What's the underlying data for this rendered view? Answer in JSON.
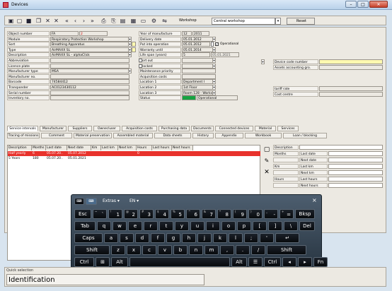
{
  "window": {
    "title": "Devices",
    "minimize": "–",
    "maximize": "□",
    "close": "✕"
  },
  "toolbar": {
    "workshop_label": "Workshop",
    "workshop_value": "Central workshop",
    "reset": "Reset"
  },
  "form": {
    "left": [
      {
        "label": "Object number",
        "value": "FA",
        "extra": "2"
      },
      {
        "label": "Module",
        "value": "Respiratory Protection Workshop"
      },
      {
        "label": "Sort",
        "value": "Breathing Apparatus"
      },
      {
        "label": "Type",
        "value": "AirMAXX SL"
      },
      {
        "label": "Description",
        "value": "AirMAXX SL - alphaClick"
      },
      {
        "label": "Abbreviation",
        "value": ""
      },
      {
        "label": "Licence plate",
        "value": ""
      },
      {
        "label": "Manufacturer type",
        "value": "MSA"
      },
      {
        "label": "Manufacturer no.",
        "value": ""
      },
      {
        "label": "Barcode",
        "value": "74584412"
      },
      {
        "label": "Transponder",
        "value": "AC0123430112"
      },
      {
        "label": "Serial number",
        "value": ""
      },
      {
        "label": "Inventory no.",
        "value": ""
      }
    ],
    "mid": [
      {
        "label": "Year of manufacture",
        "value": "12",
        "value2": "2011"
      },
      {
        "label": "Delivery date",
        "value": "05.01.2012"
      },
      {
        "label": "Put into operation",
        "value": "05.01.2012",
        "value2": "Operational"
      },
      {
        "label": "Warranty until",
        "value": "05.01.2014"
      },
      {
        "label": "Life span (years)",
        "value": "5",
        "value2": "05.01.2021"
      },
      {
        "label": "Sort out",
        "value": ""
      },
      {
        "label": "Blocked",
        "value": ""
      },
      {
        "label": "Maintenance priority",
        "value": ""
      },
      {
        "label": "Acquisition costs",
        "value": ""
      },
      {
        "label": "Location 1",
        "value": "Department I"
      },
      {
        "label": "Location 2",
        "value": "1st Floor"
      },
      {
        "label": "Location 3",
        "value": "Room 128 - Workshop"
      },
      {
        "label": "Status",
        "value": "Operational"
      }
    ],
    "right": [
      {
        "label": "Device code number",
        "value": ""
      },
      {
        "label": "Assets accounting gro.",
        "value": ""
      },
      {
        "label": "tariff rate",
        "value": ""
      },
      {
        "label": "Cost centre",
        "value": ""
      }
    ]
  },
  "tabs_row1": [
    "Service intervals",
    "Manufacturer",
    "Suppliers",
    "Owner/user",
    "Acquisition costs",
    "Purchasing data",
    "Documents",
    "Connected devices",
    "Material",
    "Services"
  ],
  "tabs_row2": [
    "Tracing of missions",
    "Comment",
    "Material preservation",
    "Assembled material",
    "Data sheets",
    "History",
    "Appendix",
    "Workbook",
    "Loan / blocking"
  ],
  "table": {
    "headers": [
      "Description",
      "Months",
      "Last date",
      "Next date",
      "Km",
      "Last km",
      "Next km",
      "Hours",
      "Last hours",
      "Next hours"
    ],
    "rows": [
      [
        "Half yearly",
        "6",
        "05.07.20..",
        "05.07.2012",
        "",
        "",
        "",
        "0",
        "",
        ""
      ],
      [
        "5 Years",
        "180",
        "05.07.20..",
        "05.01.2021",
        "",
        "",
        "",
        "",
        "",
        ""
      ]
    ]
  },
  "detail": {
    "rows": [
      {
        "label": "Description",
        "value": ""
      },
      {
        "label": "Months",
        "value": "Last date"
      },
      {
        "label": "",
        "value": "Next date"
      },
      {
        "label": "Km",
        "value": "Last km"
      },
      {
        "label": "",
        "value": "Next km"
      },
      {
        "label": "Hours",
        "value": "Last hours"
      },
      {
        "label": "",
        "value": "Next hours"
      }
    ]
  },
  "keyboard": {
    "top": [
      "Extras",
      "EN"
    ],
    "row1": [
      "Esc",
      "`",
      "1",
      "2",
      "3",
      "4",
      "5",
      "6",
      "7",
      "8",
      "9",
      "0",
      "-",
      "=",
      "Bksp"
    ],
    "row1sub": [
      "",
      "~",
      "!",
      "@",
      "#",
      "$",
      "%",
      "^",
      "&",
      "*",
      "(",
      ")",
      "_",
      "+",
      ""
    ],
    "row2": [
      "Tab",
      "q",
      "w",
      "e",
      "r",
      "t",
      "y",
      "u",
      "i",
      "o",
      "p",
      "[",
      "]",
      "\\",
      "Del"
    ],
    "row3": [
      "Caps",
      "a",
      "s",
      "d",
      "f",
      "g",
      "h",
      "j",
      "k",
      "l",
      ";",
      "'",
      "↵"
    ],
    "row4": [
      "Shift",
      "z",
      "x",
      "c",
      "v",
      "b",
      "n",
      "m",
      ",",
      ".",
      "/",
      "Shift"
    ],
    "row5": [
      "Ctrl",
      "⊞",
      "Alt",
      "",
      "Alt",
      "☰",
      "Ctrl",
      "◂",
      "▸",
      "Fn"
    ]
  },
  "quick": {
    "label": "Quick selection",
    "value": "Identification"
  }
}
